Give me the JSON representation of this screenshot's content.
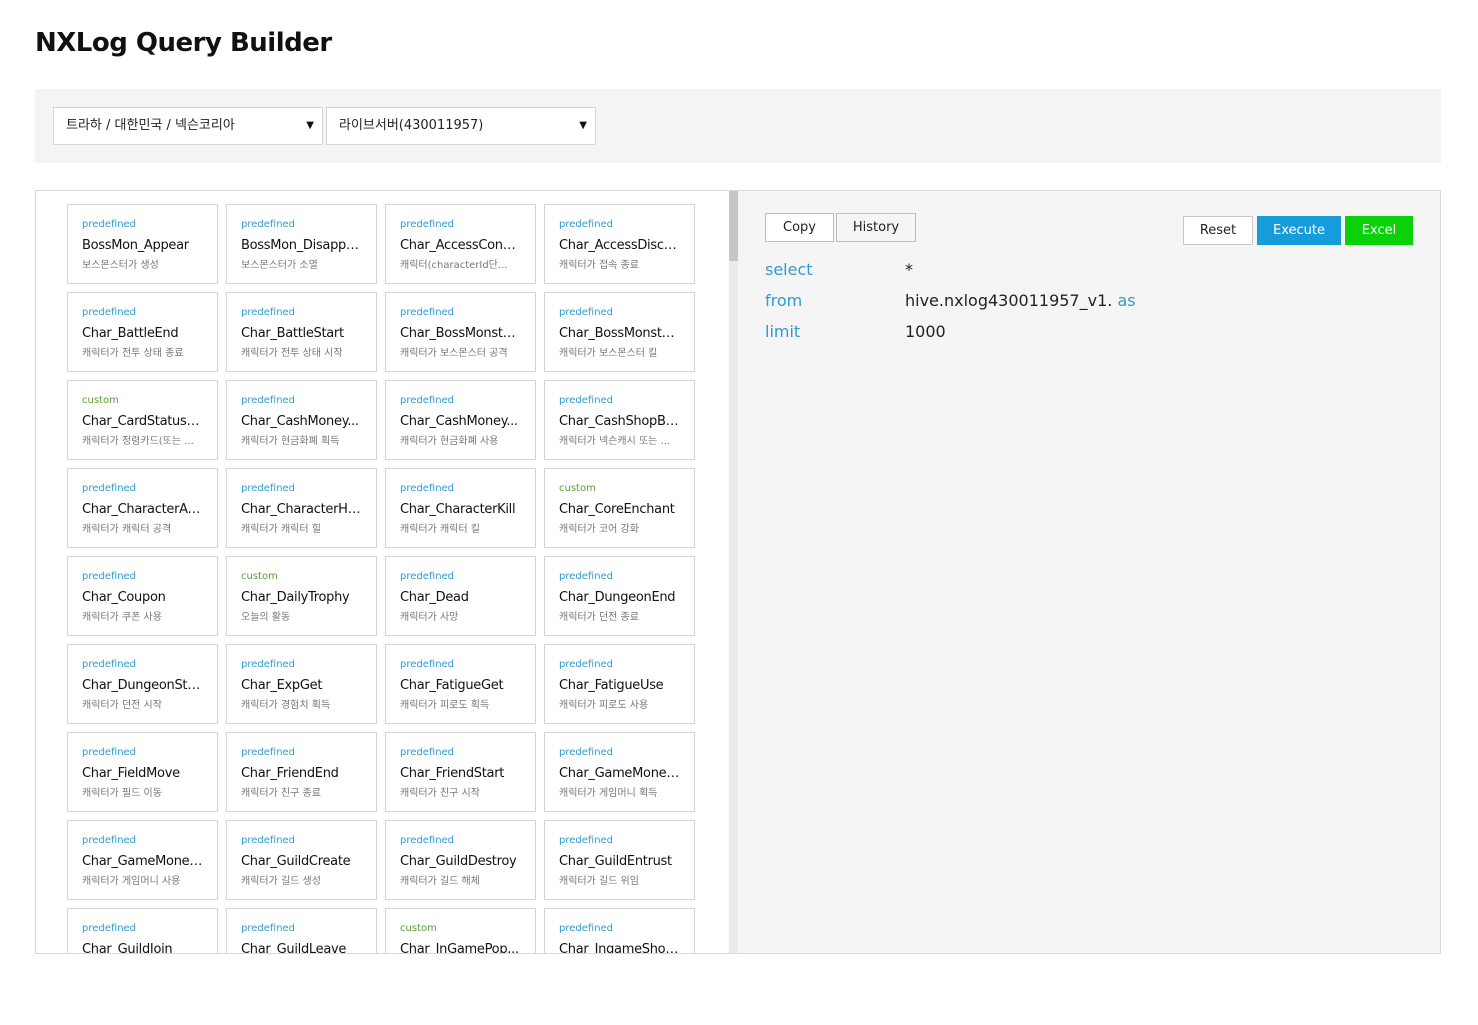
{
  "title": "NXLog Query Builder",
  "selectors": {
    "game": "트라하 / 대한민국 / 넥슨코리아",
    "server": "라이브서버(430011957)",
    "caret": "▼"
  },
  "toolbar": {
    "copy": "Copy",
    "history": "History",
    "reset": "Reset",
    "execute": "Execute",
    "excel": "Excel"
  },
  "colors": {
    "accent": "#2e9ad6",
    "execute": "#169bdb",
    "excel": "#0bd10b",
    "custom": "#5a9e36"
  },
  "query": {
    "select": {
      "key": "select",
      "value": "*"
    },
    "from": {
      "key": "from",
      "value": "hive.nxlog430011957_v1.",
      "alias": "as"
    },
    "limit": {
      "key": "limit",
      "value": "1000"
    }
  },
  "events": [
    {
      "type": "predefined",
      "name": "BossMon_Appear",
      "desc": "보스몬스터가 생성"
    },
    {
      "type": "predefined",
      "name": "BossMon_Disappear",
      "desc": "보스몬스터가 소멸"
    },
    {
      "type": "predefined",
      "name": "Char_AccessConn...",
      "desc": "캐릭터(characterId단..."
    },
    {
      "type": "predefined",
      "name": "Char_AccessDisco...",
      "desc": "캐릭터가 접속 종료"
    },
    {
      "type": "predefined",
      "name": "Char_BattleEnd",
      "desc": "캐릭터가 전투 상태 종료"
    },
    {
      "type": "predefined",
      "name": "Char_BattleStart",
      "desc": "캐릭터가 전투 상태 시작"
    },
    {
      "type": "predefined",
      "name": "Char_BossMonster...",
      "desc": "캐릭터가 보스몬스터 공격"
    },
    {
      "type": "predefined",
      "name": "Char_BossMonster...",
      "desc": "캐릭터가 보스몬스터 킬"
    },
    {
      "type": "custom",
      "name": "Char_CardStatusC...",
      "desc": "캐릭터가 정령카드(또는 ..."
    },
    {
      "type": "predefined",
      "name": "Char_CashMoney...",
      "desc": "캐릭터가 현금화폐 획득"
    },
    {
      "type": "predefined",
      "name": "Char_CashMoney...",
      "desc": "캐릭터가 현금화폐 사용"
    },
    {
      "type": "predefined",
      "name": "Char_CashShopBuy",
      "desc": "캐릭터가 넥슨캐시 또는 ..."
    },
    {
      "type": "predefined",
      "name": "Char_CharacterAtt...",
      "desc": "캐릭터가 캐릭터 공격"
    },
    {
      "type": "predefined",
      "name": "Char_CharacterHeal",
      "desc": "캐릭터가 캐릭터 힐"
    },
    {
      "type": "predefined",
      "name": "Char_CharacterKill",
      "desc": "캐릭터가 캐릭터 킬"
    },
    {
      "type": "custom",
      "name": "Char_CoreEnchant",
      "desc": "캐릭터가 코어 강화"
    },
    {
      "type": "predefined",
      "name": "Char_Coupon",
      "desc": "캐릭터가 쿠폰 사용"
    },
    {
      "type": "custom",
      "name": "Char_DailyTrophy",
      "desc": "오늘의 활동"
    },
    {
      "type": "predefined",
      "name": "Char_Dead",
      "desc": "캐릭터가 사망"
    },
    {
      "type": "predefined",
      "name": "Char_DungeonEnd",
      "desc": "캐릭터가 던전 종료"
    },
    {
      "type": "predefined",
      "name": "Char_DungeonStart",
      "desc": "캐릭터가 던전 시작"
    },
    {
      "type": "predefined",
      "name": "Char_ExpGet",
      "desc": "캐릭터가 경험치 획득"
    },
    {
      "type": "predefined",
      "name": "Char_FatigueGet",
      "desc": "캐릭터가 피로도 획득"
    },
    {
      "type": "predefined",
      "name": "Char_FatigueUse",
      "desc": "캐릭터가 피로도 사용"
    },
    {
      "type": "predefined",
      "name": "Char_FieldMove",
      "desc": "캐릭터가 필드 이동"
    },
    {
      "type": "predefined",
      "name": "Char_FriendEnd",
      "desc": "캐릭터가 친구 종료"
    },
    {
      "type": "predefined",
      "name": "Char_FriendStart",
      "desc": "캐릭터가 친구 시작"
    },
    {
      "type": "predefined",
      "name": "Char_GameMoney...",
      "desc": "캐릭터가 게임머니 획득"
    },
    {
      "type": "predefined",
      "name": "Char_GameMoney...",
      "desc": "캐릭터가 게임머니 사용"
    },
    {
      "type": "predefined",
      "name": "Char_GuildCreate",
      "desc": "캐릭터가 길드 생성"
    },
    {
      "type": "predefined",
      "name": "Char_GuildDestroy",
      "desc": "캐릭터가 길드 해체"
    },
    {
      "type": "predefined",
      "name": "Char_GuildEntrust",
      "desc": "캐릭터가 길드 위임"
    },
    {
      "type": "predefined",
      "name": "Char_GuildJoin",
      "desc": ""
    },
    {
      "type": "predefined",
      "name": "Char_GuildLeave",
      "desc": ""
    },
    {
      "type": "custom",
      "name": "Char_InGamePop...",
      "desc": ""
    },
    {
      "type": "predefined",
      "name": "Char_IngameShop...",
      "desc": ""
    }
  ]
}
